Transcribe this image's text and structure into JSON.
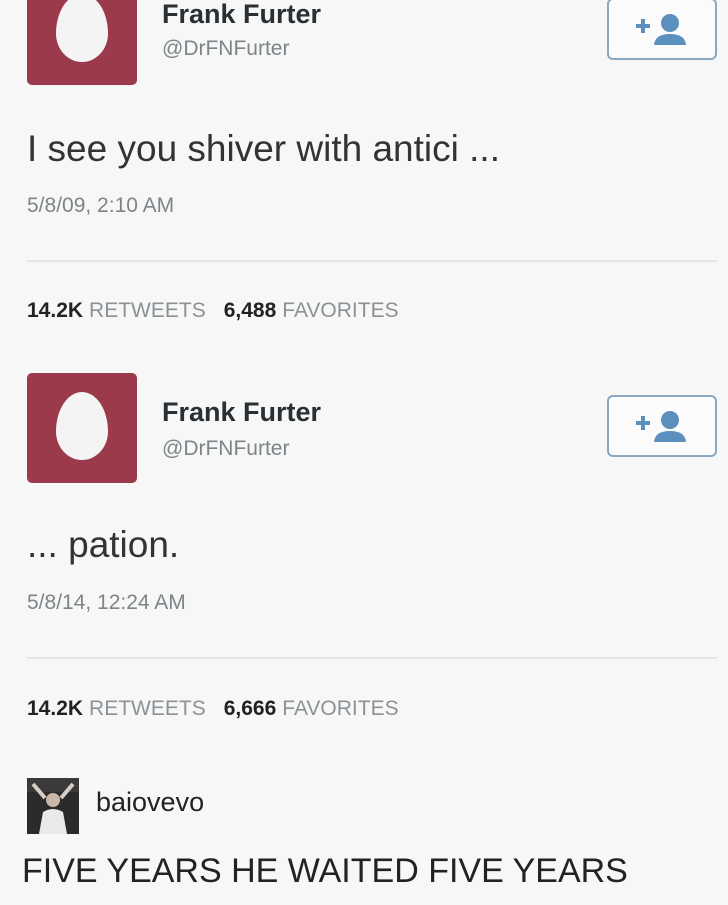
{
  "tweets": [
    {
      "name": "Frank Furter",
      "handle": "@DrFNFurter",
      "follow_icon": "follow-user-icon",
      "text": "I see you shiver with antici ...",
      "timestamp": "5/8/09, 2:10 AM",
      "retweets_count": "14.2K",
      "retweets_label": "RETWEETS",
      "favorites_count": "6,488",
      "favorites_label": "FAVORITES"
    },
    {
      "name": "Frank Furter",
      "handle": "@DrFNFurter",
      "follow_icon": "follow-user-icon",
      "text": "... pation.",
      "timestamp": "5/8/14, 12:24 AM",
      "retweets_count": "14.2K",
      "retweets_label": "RETWEETS",
      "favorites_count": "6,666",
      "favorites_label": "FAVORITES"
    }
  ],
  "comment": {
    "username": "baiovevo",
    "text": "FIVE YEARS HE WAITED FIVE YEARS"
  },
  "colors": {
    "avatar_bg": "#9b3a4b",
    "follow_border": "#8aa8c2",
    "follow_icon": "#5b8fbd",
    "muted_text": "#7d8588"
  }
}
